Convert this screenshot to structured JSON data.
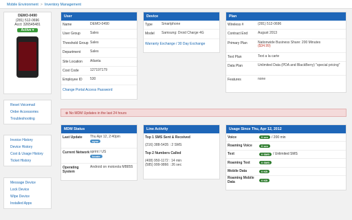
{
  "breadcrumb": [
    "Mobile Environment",
    "Inventory Management"
  ],
  "device": {
    "name": "DEMO-0490",
    "phone": "(281) 512-0696",
    "acct": "Acct: 326545481",
    "status": "Active"
  },
  "sidebar1": [
    "Reset Voicemail",
    "Order Accessories",
    "Troubleshooting"
  ],
  "sidebar2": [
    "Invoice History",
    "Device History",
    "Cost & Usage History",
    "Ticket History"
  ],
  "sidebar3": [
    "Message Device",
    "Lock Device",
    "Wipe Device",
    "Installed Apps"
  ],
  "user": {
    "title": "User",
    "rows": [
      [
        "Name",
        "DEMO-0490"
      ],
      [
        "User Group",
        "Sales"
      ],
      [
        "Threshold Group",
        "Sales"
      ],
      [
        "Department",
        "Sales"
      ],
      [
        "Site Location",
        "Atlanta"
      ],
      [
        "Cost Code",
        "127197179"
      ],
      [
        "Employee ID",
        "530"
      ]
    ],
    "link": "Change Portal Access Password"
  },
  "devicePanel": {
    "title": "Device",
    "rows": [
      [
        "Type",
        "Smartphone"
      ],
      [
        "Model",
        "Samsung: Droid Charge 4G"
      ]
    ],
    "link": "Warranty Exchange / 30 Day Exchange"
  },
  "plan": {
    "title": "Plan",
    "rows": [
      [
        "Wireless #",
        "(281) 512-0696"
      ],
      [
        "Contract End",
        "August 2013"
      ],
      [
        "Primary Plan",
        "Nationwide Business Share: 200 Minutes"
      ],
      [
        "Text Plan",
        "Text a la carte"
      ],
      [
        "Data Plan",
        "Unlimited Data (PDA and BlackBerry) \"special pricing\""
      ],
      [
        "Features",
        "none"
      ]
    ],
    "price": "($34.99)"
  },
  "alert": "No MDM Updates in the last 24 hours",
  "mdm": {
    "title": "MDM Status",
    "lastLabel": "Last Update",
    "lastVal": "Thu Apr 12, 2:40pm",
    "lastBadge": "sync",
    "netLabel": "Current Network",
    "netVal": "sprint / US",
    "netBadge": "locate",
    "osLabel": "Operating System",
    "osVal": "Android on motorola MB855"
  },
  "line": {
    "title": "Line Activity",
    "smsHeader": "Top 1 SMS Sent & Received",
    "sms": [
      "(216) 388-5435 : 2 SMS"
    ],
    "callHeader": "Top 2 Numbers Called",
    "calls": [
      "(408) 950-1172 : 14 min",
      "(585) 999-9866 : 26 sec"
    ]
  },
  "usage": {
    "title": "Usage Since Thu, Apr 12, 2012",
    "rows": [
      {
        "label": "Voice",
        "badge": "0 sec",
        "note": "/ 200 min"
      },
      {
        "label": "Roaming Voice",
        "badge": "0 sec",
        "note": ""
      },
      {
        "label": "Text",
        "badge": "0 SMS",
        "note": "/ Unlimited SMS"
      },
      {
        "label": "Roaming Text",
        "badge": "0 SMS",
        "note": ""
      },
      {
        "label": "Mobile Data",
        "badge": "0 KB",
        "note": ""
      },
      {
        "label": "Roaming Mobile Data",
        "badge": "0 KB",
        "note": ""
      }
    ]
  }
}
